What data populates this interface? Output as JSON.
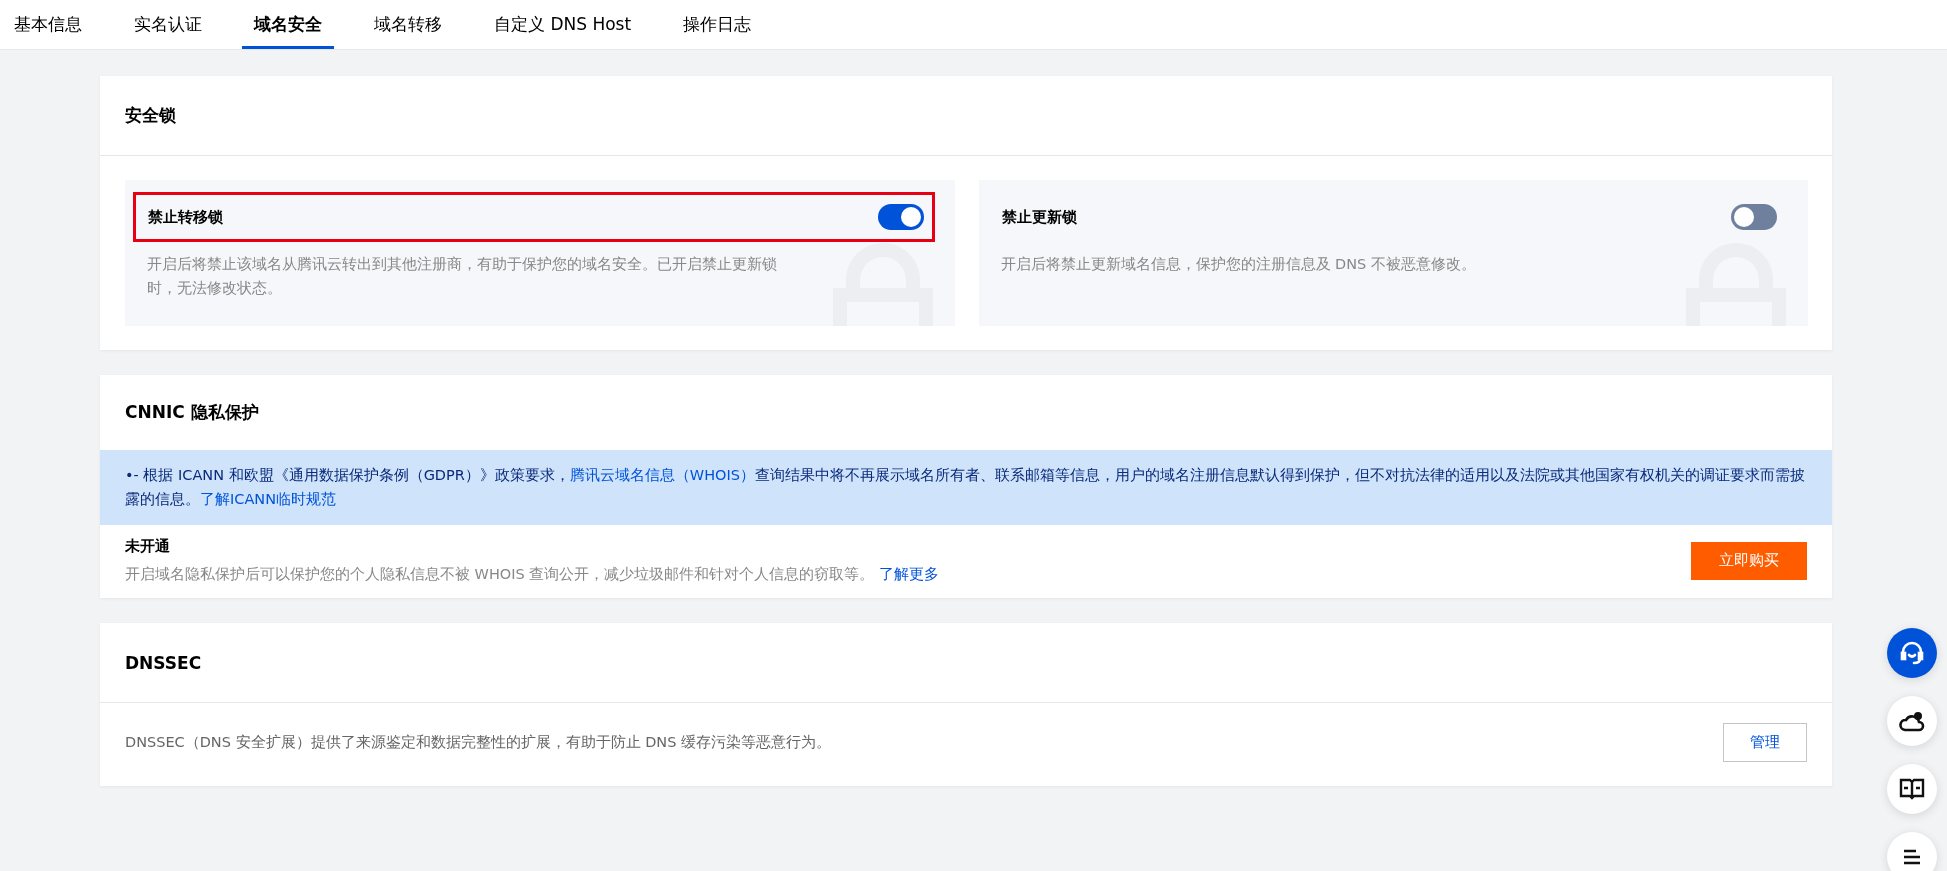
{
  "tabs": [
    {
      "label": "基本信息",
      "selected": false
    },
    {
      "label": "实名认证",
      "selected": false
    },
    {
      "label": "域名安全",
      "selected": true
    },
    {
      "label": "域名转移",
      "selected": false
    },
    {
      "label": "自定义 DNS Host",
      "selected": false
    },
    {
      "label": "操作日志",
      "selected": false
    }
  ],
  "security_lock": {
    "title": "安全锁",
    "locks": [
      {
        "title": "禁止转移锁",
        "description": "开启后将禁止该域名从腾讯云转出到其他注册商，有助于保护您的域名安全。已开启禁止更新锁时，无法修改状态。",
        "on": true,
        "highlighted": true
      },
      {
        "title": "禁止更新锁",
        "description": "开启后将禁止更新域名信息，保护您的注册信息及 DNS 不被恶意修改。",
        "on": false,
        "highlighted": false
      }
    ]
  },
  "privacy": {
    "title": "CNNIC 隐私保护",
    "notice": {
      "bullet": "•",
      "parts": [
        {
          "kind": "text",
          "text": "- 根据 ICANN 和欧盟《通用数据保护条例（GDPR）》政策要求，"
        },
        {
          "kind": "link",
          "text": "腾讯云域名信息（WHOIS）"
        },
        {
          "kind": "text",
          "text": "查询结果中将不再展示域名所有者、联系邮箱等信息，用户的域名注册信息默认得到保护，但不对抗法律的适用以及法院或其他国家有权机关的调证要求而需披露的信息。"
        },
        {
          "kind": "link",
          "text": "了解ICANN临时规范"
        }
      ]
    },
    "status": "未开通",
    "description": "开启域名隐私保护后可以保护您的个人隐私信息不被 WHOIS 查询公开，减少垃圾邮件和针对个人信息的窃取等。",
    "more_link": "了解更多",
    "buy_button": "立即购买"
  },
  "dnssec": {
    "title": "DNSSEC",
    "description": "DNSSEC（DNS 安全扩展）提供了来源鉴定和数据完整性的扩展，有助于防止 DNS 缓存污染等恶意行为。",
    "manage_button": "管理"
  }
}
